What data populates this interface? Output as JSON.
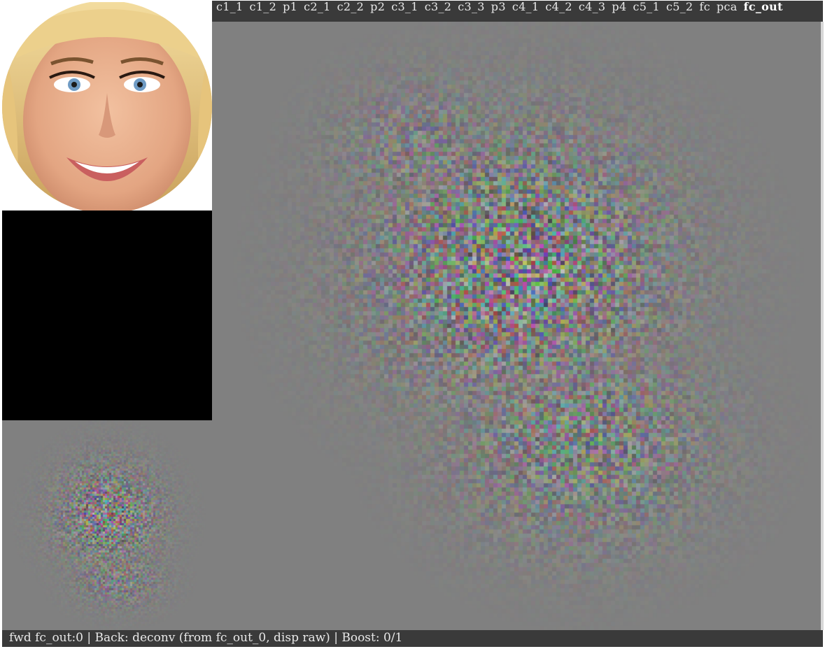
{
  "layer_bar": {
    "layers": [
      "c1_1",
      "c1_2",
      "p1",
      "c2_1",
      "c2_2",
      "p2",
      "c3_1",
      "c3_2",
      "c3_3",
      "p3",
      "c4_1",
      "c4_2",
      "c4_3",
      "p4",
      "c5_1",
      "c5_2",
      "fc",
      "pca",
      "fc_out"
    ],
    "selected": "fc_out"
  },
  "status_bar": {
    "text": "fwd fc_out:0 | Back: deconv (from fc_out_0, disp raw) | Boost: 0/1"
  },
  "colors": {
    "bar_background": "#3a3a3a",
    "bar_text": "#e8e8e8",
    "viz_background": "#808080",
    "backprop_panel": "#000000"
  },
  "panels": {
    "input_image_icon": "face-photo",
    "backprop_panel_icon": "blank-black"
  }
}
